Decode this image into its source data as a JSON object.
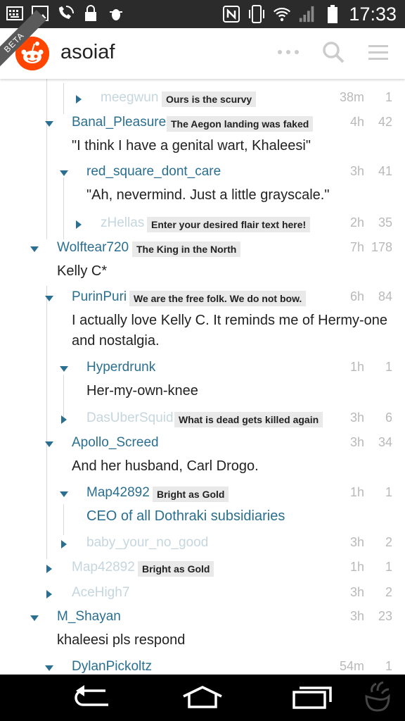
{
  "status_bar": {
    "time": "17:33",
    "icons_left": [
      "keyboard-icon",
      "image-icon",
      "wifi-call-icon",
      "lock-icon",
      "debug-icon"
    ],
    "icons_right": [
      "nfc-icon",
      "vibrate-icon",
      "wifi-icon",
      "signal-icon",
      "battery-icon"
    ]
  },
  "app_bar": {
    "badge": "BETA",
    "title": "asoiaf",
    "actions": [
      "more-icon",
      "search-icon",
      "menu-icon"
    ]
  },
  "comments": [
    {
      "user": "meegwun",
      "flair": "Ours is the scurvy",
      "time": "38m",
      "score": "1",
      "collapsed": true,
      "faded": true,
      "body": ""
    },
    {
      "user": "Banal_Pleasure",
      "flair": "The Aegon landing was faked",
      "time": "4h",
      "score": "42",
      "collapsed": false,
      "faded": false,
      "body": "\"I think I have a genital wart, Khaleesi\""
    },
    {
      "user": "red_square_dont_care",
      "flair": "",
      "time": "3h",
      "score": "41",
      "collapsed": false,
      "faded": false,
      "body": "\"Ah, nevermind. Just a little grayscale.\""
    },
    {
      "user": "zHellas",
      "flair": "Enter your desired flair text here!",
      "time": "2h",
      "score": "35",
      "collapsed": true,
      "faded": true,
      "body": ""
    },
    {
      "user": "Wolftear720",
      "flair": "The King in the North",
      "time": "7h",
      "score": "178",
      "collapsed": false,
      "faded": false,
      "body": "Kelly C*"
    },
    {
      "user": "PurinPuri",
      "flair": "We are the free folk. We do not bow.",
      "time": "6h",
      "score": "84",
      "collapsed": false,
      "faded": false,
      "body": "I actually love Kelly C. It reminds me of Hermy-one and nostalgia."
    },
    {
      "user": "Hyperdrunk",
      "flair": "",
      "time": "1h",
      "score": "1",
      "collapsed": false,
      "faded": false,
      "body": "Her-my-own-knee"
    },
    {
      "user": "DasUberSquid",
      "flair": "What is dead gets killed again",
      "time": "3h",
      "score": "6",
      "collapsed": true,
      "faded": true,
      "body": ""
    },
    {
      "user": "Apollo_Screed",
      "flair": "",
      "time": "3h",
      "score": "34",
      "collapsed": false,
      "faded": false,
      "body": "And her husband, Carl Drogo."
    },
    {
      "user": "Map42892",
      "flair": "Bright as Gold",
      "time": "1h",
      "score": "1",
      "collapsed": false,
      "faded": false,
      "body": "CEO of all Dothraki subsidiaries",
      "body_link": true
    },
    {
      "user": "baby_your_no_good",
      "flair": "",
      "time": "3h",
      "score": "2",
      "collapsed": true,
      "faded": true,
      "body": ""
    },
    {
      "user": "Map42892",
      "flair": "Bright as Gold",
      "time": "1h",
      "score": "1",
      "collapsed": true,
      "faded": true,
      "body": ""
    },
    {
      "user": "AceHigh7",
      "flair": "",
      "time": "3h",
      "score": "2",
      "collapsed": true,
      "faded": true,
      "body": ""
    },
    {
      "user": "M_Shayan",
      "flair": "",
      "time": "3h",
      "score": "23",
      "collapsed": false,
      "faded": false,
      "body": "khaleesi pls respond"
    },
    {
      "user": "DylanPickoltz",
      "flair": "",
      "time": "54m",
      "score": "1",
      "collapsed": false,
      "faded": false,
      "body": ""
    }
  ],
  "nav_bar": [
    "back-icon",
    "home-icon",
    "recent-apps-icon"
  ],
  "colors": {
    "accent": "#2a6f8f",
    "brand": "#ff4500",
    "flair_bg": "#e9e9e9",
    "muted": "#b9b9b9"
  }
}
